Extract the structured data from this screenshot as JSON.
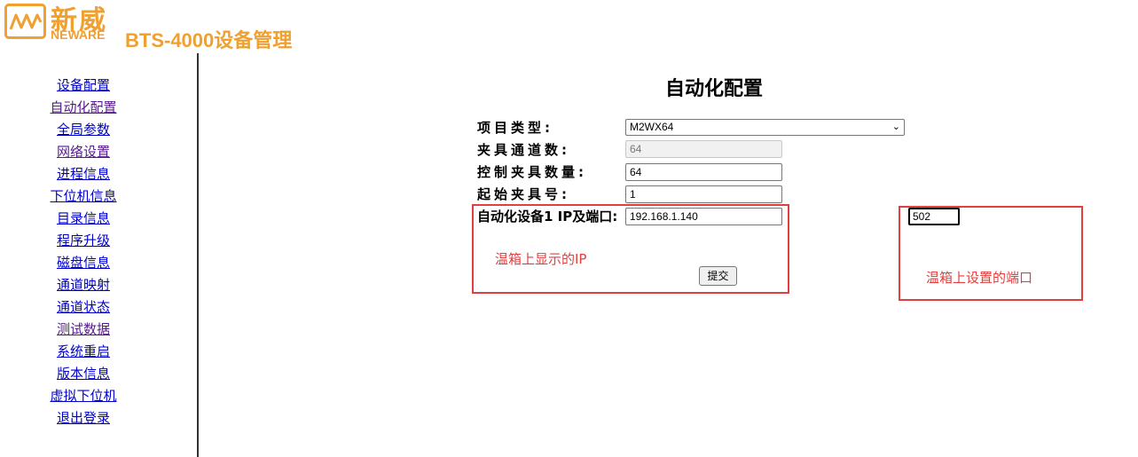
{
  "header": {
    "logo_cn": "新威",
    "logo_en": "NEWARE",
    "app_title": "BTS-4000设备管理"
  },
  "sidebar": {
    "items": [
      {
        "label": "设备配置"
      },
      {
        "label": "自动化配置"
      },
      {
        "label": "全局参数"
      },
      {
        "label": "网络设置"
      },
      {
        "label": "进程信息"
      },
      {
        "label": "下位机信息"
      },
      {
        "label": "目录信息"
      },
      {
        "label": "程序升级"
      },
      {
        "label": "磁盘信息"
      },
      {
        "label": "通道映射"
      },
      {
        "label": "通道状态"
      },
      {
        "label": "测试数据"
      },
      {
        "label": "系统重启"
      },
      {
        "label": "版本信息"
      },
      {
        "label": "虚拟下位机"
      },
      {
        "label": "退出登录"
      }
    ]
  },
  "main": {
    "title": "自动化配置",
    "form": {
      "project_type_label": "项目类型:",
      "project_type_value": "M2WX64",
      "channel_count_label": "夹具通道数:",
      "channel_count_value": "64",
      "fixture_count_label": "控制夹具数量:",
      "fixture_count_value": "64",
      "start_fixture_label": "起始夹具号:",
      "start_fixture_value": "1",
      "device_ip_label": "自动化设备1 IP及端口:",
      "device_ip_value": "192.168.1.140",
      "device_port_value": "502",
      "submit_label": "提交"
    }
  },
  "annotations": {
    "ip_note": "温箱上显示的IP",
    "port_note": "温箱上设置的端口",
    "color": "#e04040"
  },
  "colors": {
    "brand": "#f0a030",
    "link": "#0000cc",
    "visited_link": "#551a8b"
  }
}
